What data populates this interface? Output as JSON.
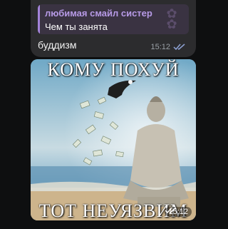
{
  "messages": [
    {
      "reply": {
        "author": "любимая смайл систер",
        "text": "Чем ты занята"
      },
      "text": "буддизм",
      "time": "15:12",
      "status_icon": "double-check-icon"
    },
    {
      "image": {
        "caption_top": "КОМУ ПОХУЙ",
        "caption_bottom": "ТОТ НЕУЯЗВИМ",
        "description_icon": "buddha-photo"
      },
      "time": "15:12",
      "status_icon": "double-check-icon"
    }
  ],
  "colors": {
    "background": "#0e0f10",
    "bubble": "#2c2c2e",
    "reply_accent": "#a383d9",
    "reply_author": "#b79ae6",
    "check": "#8fa3d6"
  }
}
